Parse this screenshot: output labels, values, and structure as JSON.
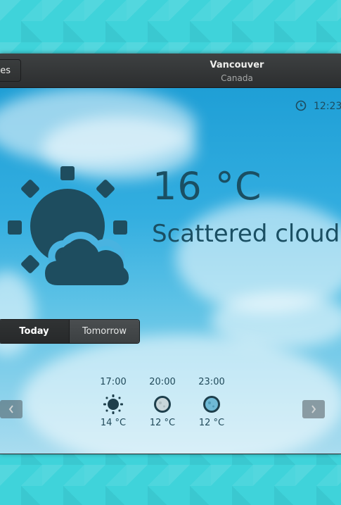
{
  "header": {
    "back_label": "es",
    "title": "Vancouver",
    "subtitle": "Canada"
  },
  "current": {
    "time": "12:23",
    "temperature": "16 °C",
    "condition": "Scattered clouds",
    "icon": "sun-behind-cloud-icon"
  },
  "switcher": {
    "today": "Today",
    "tomorrow": "Tomorrow",
    "selected": "Today"
  },
  "forecast": [
    {
      "time": "17:00",
      "temp": "14 °C",
      "icon": "sun-icon"
    },
    {
      "time": "20:00",
      "temp": "12 °C",
      "icon": "moon-icon"
    },
    {
      "time": "23:00",
      "temp": "12 °C",
      "icon": "moon-icon"
    }
  ],
  "colors": {
    "accent_text": "#1a4f63",
    "headerbar": "#2c2e2f",
    "wallpaper": "#3fd3da"
  }
}
